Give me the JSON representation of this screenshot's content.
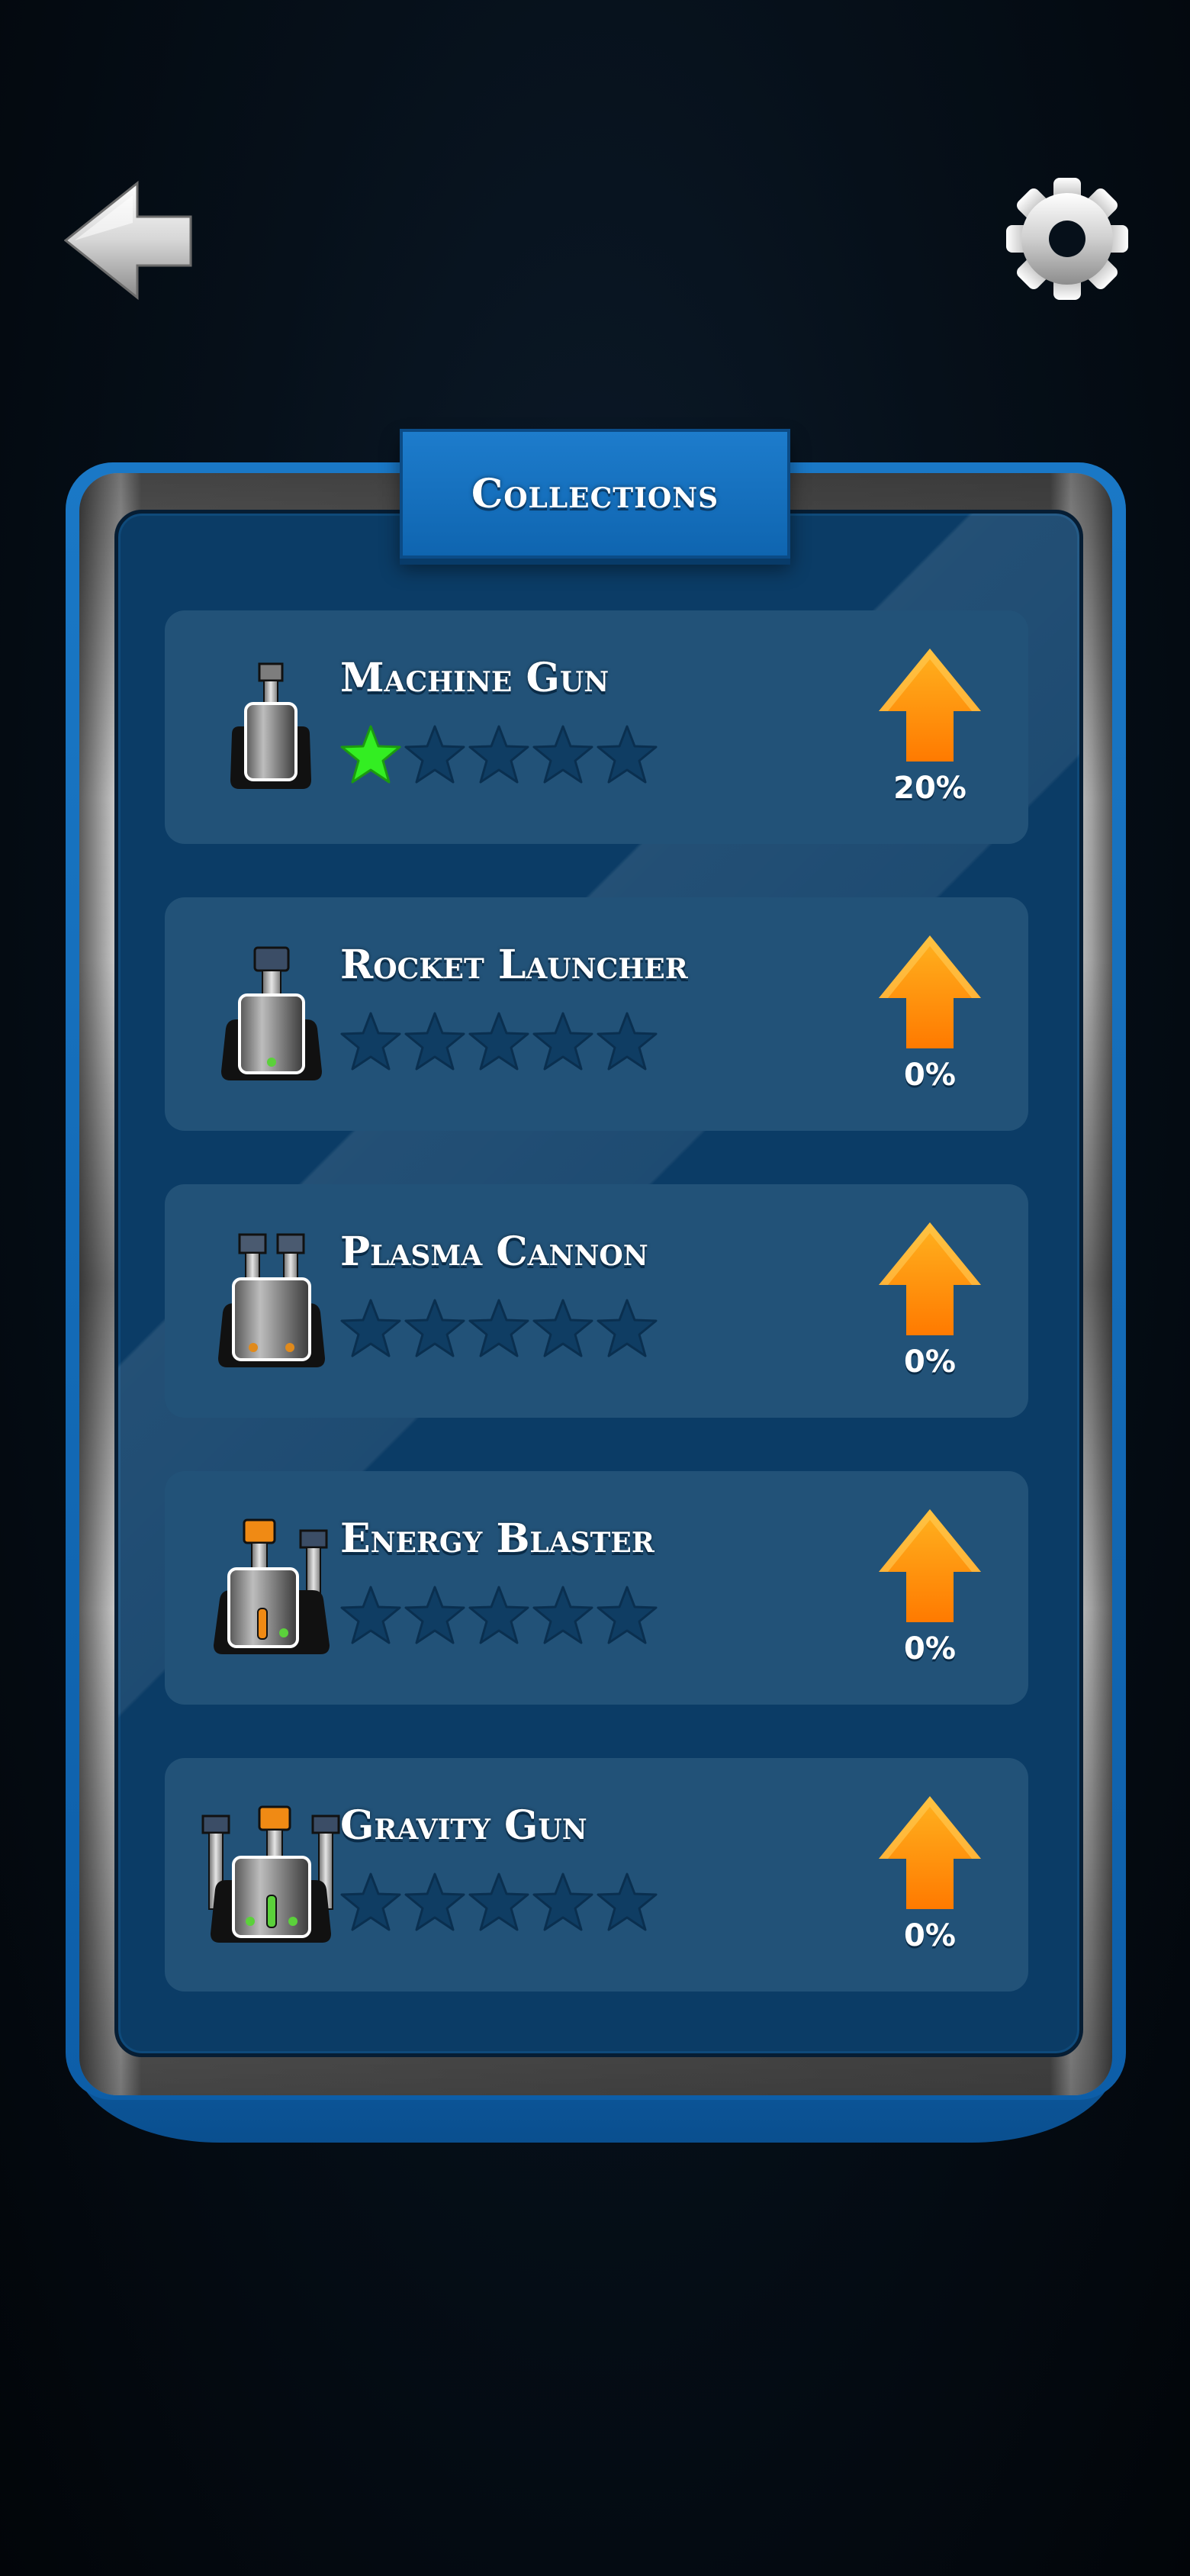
{
  "header": {
    "back_icon": "back-arrow-icon",
    "settings_icon": "gear-icon"
  },
  "panel": {
    "title": "Collections"
  },
  "colors": {
    "star_filled": "#33ee22",
    "star_empty": "#0f3d63",
    "upgrade_arrow": "#ff9100",
    "panel_bg": "#0b3c66",
    "row_bg": "#225278",
    "frame_blue": "#1a78c6"
  },
  "weapons": [
    {
      "name": "Machine Gun",
      "stars_filled": 1,
      "stars_total": 5,
      "progress": "20%",
      "icon": "machine-gun-turret-icon"
    },
    {
      "name": "Rocket Launcher",
      "stars_filled": 0,
      "stars_total": 5,
      "progress": "0%",
      "icon": "rocket-launcher-turret-icon"
    },
    {
      "name": "Plasma Cannon",
      "stars_filled": 0,
      "stars_total": 5,
      "progress": "0%",
      "icon": "plasma-cannon-turret-icon"
    },
    {
      "name": "Energy Blaster",
      "stars_filled": 0,
      "stars_total": 5,
      "progress": "0%",
      "icon": "energy-blaster-turret-icon"
    },
    {
      "name": "Gravity Gun",
      "stars_filled": 0,
      "stars_total": 5,
      "progress": "0%",
      "icon": "gravity-gun-turret-icon"
    }
  ]
}
